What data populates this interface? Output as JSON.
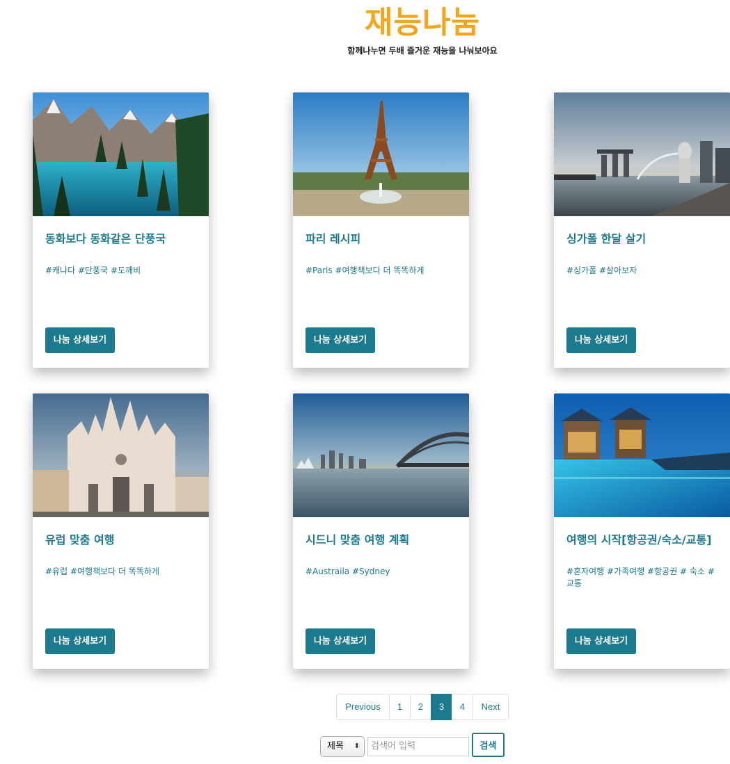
{
  "header": {
    "brand": "재능나눔",
    "subtitle": "함께나누면 두배 즐거운 재능을 나눠보아요"
  },
  "cards": [
    {
      "title": "동화보다 동화같은 단풍국",
      "tags": "#캐나다 #단풍국 #도깨비",
      "button": "나눔 상세보기"
    },
    {
      "title": "파리 레시피",
      "tags": "#Paris #여행책보다 더 똑똑하게",
      "button": "나눔 상세보기"
    },
    {
      "title": "싱가폴 한달 살기",
      "tags": "#싱가폴 #살아보자",
      "button": "나눔 상세보기"
    },
    {
      "title": "유럽 맞춤 여행",
      "tags": "#유럽 #여행책보다 더 똑똑하게",
      "button": "나눔 상세보기"
    },
    {
      "title": "시드니 맞춤 여행 계획",
      "tags": "#Austraila #Sydney",
      "button": "나눔 상세보기"
    },
    {
      "title": "여행의 시작[항공권/숙소/교통]",
      "tags": "#혼자여행 #가족여행 #항공권 # 숙소 # 교통",
      "button": "나눔 상세보기"
    }
  ],
  "pagination": {
    "previous": "Previous",
    "pages": [
      "1",
      "2",
      "3",
      "4"
    ],
    "active": "3",
    "next": "Next"
  },
  "search": {
    "select_value": "제목",
    "placeholder": "검색어 입력",
    "button": "검색"
  },
  "colors": {
    "accent": "#1b7a8e",
    "brand": "#f3a51c"
  }
}
